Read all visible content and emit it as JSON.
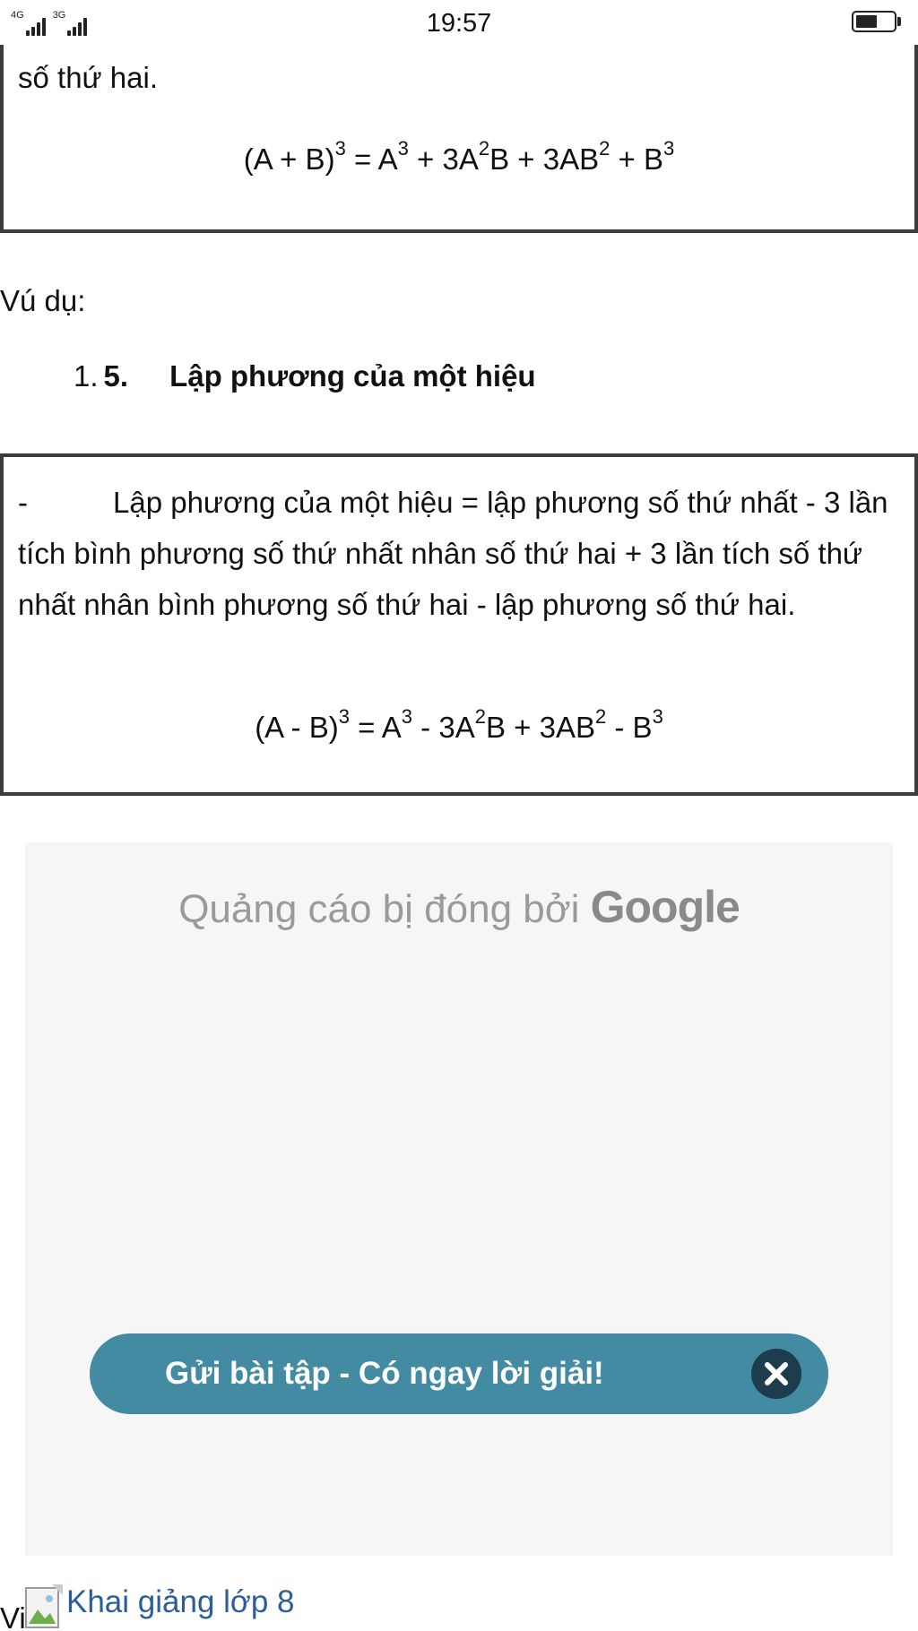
{
  "status_bar": {
    "network_1": "4G",
    "network_2": "3G",
    "time": "19:57",
    "battery_level": 0.6
  },
  "box1": {
    "text": "số thứ hai.",
    "formula": {
      "lhs_open": "(A + B)",
      "lhs_exp": "3",
      "t1": " = A",
      "t1_exp": "3",
      "t2": " + 3A",
      "t2_exp": "2",
      "t3": "B + 3AB",
      "t3_exp": "2",
      "t4": " + B",
      "t4_exp": "3"
    }
  },
  "example_label": "Vú dụ:",
  "section": {
    "number": "1.",
    "sub_number": "5.",
    "title": "Lập phương của một hiệu"
  },
  "box2": {
    "dash": "-",
    "text": "Lập phương của một hiệu = lập phương số thứ nhất - 3 lần tích bình phương số thứ nhất nhân số thứ hai + 3 lần tích số thứ nhất nhân bình phương số thứ hai - lập phương số thứ hai.",
    "formula": {
      "lhs_open": "(A - B)",
      "lhs_exp": "3",
      "t1": " = A",
      "t1_exp": "3",
      "t2": " - 3A",
      "t2_exp": "2",
      "t3": "B + 3AB",
      "t3_exp": "2",
      "t4": " - B",
      "t4_exp": "3"
    }
  },
  "ad": {
    "closed_text": "Quảng cáo bị đóng bởi ",
    "brand": "Google"
  },
  "cta": {
    "label": "Gửi bài tập - Có ngay lời giải!",
    "close_icon": "close-icon"
  },
  "bottom": {
    "prefix": "Vi",
    "link_text": "Khai giảng lớp 8",
    "image_icon": "broken-image-icon"
  },
  "colors": {
    "cta_background": "#438aa3",
    "cta_close_background": "#1d3d4d",
    "link": "#2b5d9a",
    "box_border": "#3c3c3c",
    "ad_background": "#f6f6f6"
  }
}
